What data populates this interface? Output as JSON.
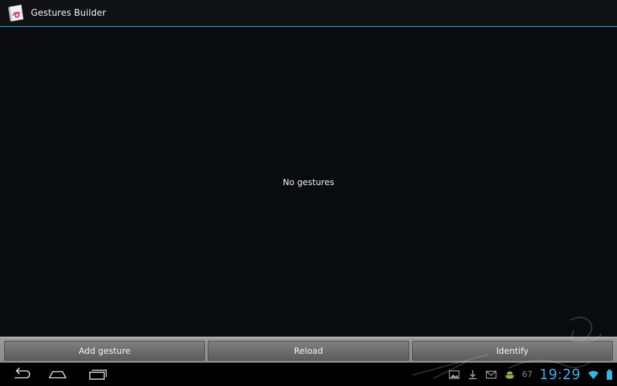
{
  "app": {
    "title": "Gestures Builder",
    "icon": "gestures-builder-app-icon"
  },
  "colors": {
    "accent": "#33b5e5",
    "background": "#0a0b0e",
    "icon_accent": "#d6336c"
  },
  "content": {
    "empty_message": "No gestures"
  },
  "buttons": {
    "add_gesture": "Add gesture",
    "reload": "Reload",
    "identify": "Identify"
  },
  "system_bar": {
    "nav": [
      "back-icon",
      "home-icon",
      "recent-apps-icon"
    ],
    "notifications": [
      "gallery-icon",
      "download-icon",
      "gmail-icon",
      "android-icon"
    ],
    "battery_level": "67",
    "clock": "19:29",
    "status_icons": [
      "wifi-icon",
      "battery-icon"
    ]
  }
}
